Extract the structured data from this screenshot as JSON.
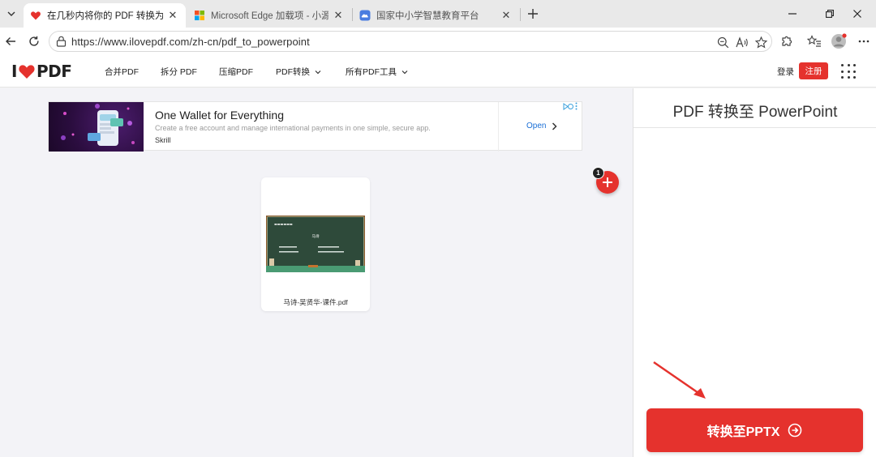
{
  "browser": {
    "tabs": [
      {
        "title": "在几秒内将你的 PDF 转换为 PPT 转",
        "active": true
      },
      {
        "title": "Microsoft Edge 加载项 - 小源教材",
        "active": false
      },
      {
        "title": "国家中小学智慧教育平台",
        "active": false
      }
    ],
    "url": "https://www.ilovepdf.com/zh-cn/pdf_to_powerpoint"
  },
  "site": {
    "logo_left": "I",
    "logo_right": "PDF",
    "nav": [
      {
        "label": "合并PDF",
        "has_dropdown": false
      },
      {
        "label": "拆分 PDF",
        "has_dropdown": false
      },
      {
        "label": "压缩PDF",
        "has_dropdown": false
      },
      {
        "label": "PDF转换",
        "has_dropdown": true
      },
      {
        "label": "所有PDF工具",
        "has_dropdown": true
      }
    ],
    "login": "登录",
    "register": "注册",
    "brand_color": "#e5322d"
  },
  "ad": {
    "title": "One Wallet for Everything",
    "subtitle": "Create a free account and manage international payments in one simple, secure app.",
    "brand": "Skrill",
    "cta": "Open"
  },
  "file": {
    "name": "马诗-吴贤华-课件.pdf",
    "count_badge": "1",
    "slide_heading": "马诗"
  },
  "panel": {
    "title": "PDF 转换至 PowerPoint",
    "convert_label": "转换至PPTX"
  }
}
